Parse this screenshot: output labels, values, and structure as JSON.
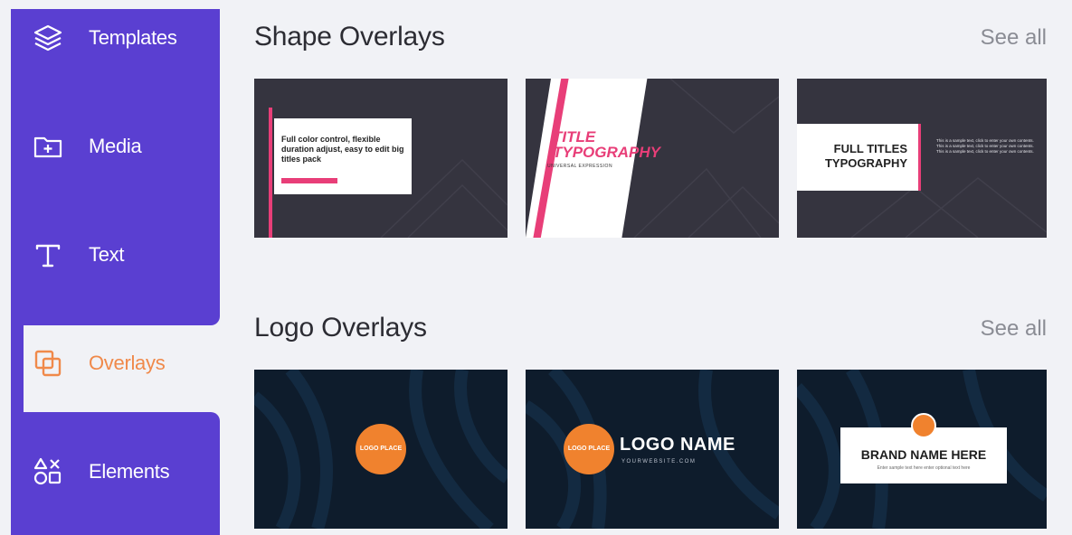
{
  "sidebar": {
    "items": [
      {
        "label": "Templates",
        "icon": "layers-icon"
      },
      {
        "label": "Media",
        "icon": "folder-plus-icon"
      },
      {
        "label": "Text",
        "icon": "text-t-icon"
      },
      {
        "label": "Overlays",
        "icon": "overlays-icon",
        "active": true
      },
      {
        "label": "Elements",
        "icon": "shapes-icon"
      }
    ]
  },
  "sections": [
    {
      "title": "Shape Overlays",
      "see_all": "See all",
      "thumbs": [
        {
          "text": "Full color control, flexible duration adjust, easy to edit big titles pack"
        },
        {
          "title_line1": "TITLE",
          "title_line2": "TYPOGRAPHY",
          "subtitle": "UNIVERSAL EXPRESSION"
        },
        {
          "title_line1": "FULL TITLES",
          "title_line2": "TYPOGRAPHY",
          "paragraph": "This is a sample text, click to enter your own contents. This is a sample text, click to enter your own contents. This is a sample text, click to enter your own contents."
        }
      ]
    },
    {
      "title": "Logo Overlays",
      "see_all": "See all",
      "thumbs": [
        {
          "circle_text": "LOGO PLACE"
        },
        {
          "circle_text": "LOGO PLACE",
          "name": "LOGO NAME",
          "url": "YOURWEBSITE.COM"
        },
        {
          "title": "BRAND NAME HERE",
          "subtitle": "Enter sample text here enter optional text here"
        }
      ]
    }
  ],
  "colors": {
    "sidebar_bg": "#5a3fd1",
    "accent_orange": "#f0894a",
    "accent_pink": "#e83e78",
    "page_bg": "#f1f2f6"
  }
}
